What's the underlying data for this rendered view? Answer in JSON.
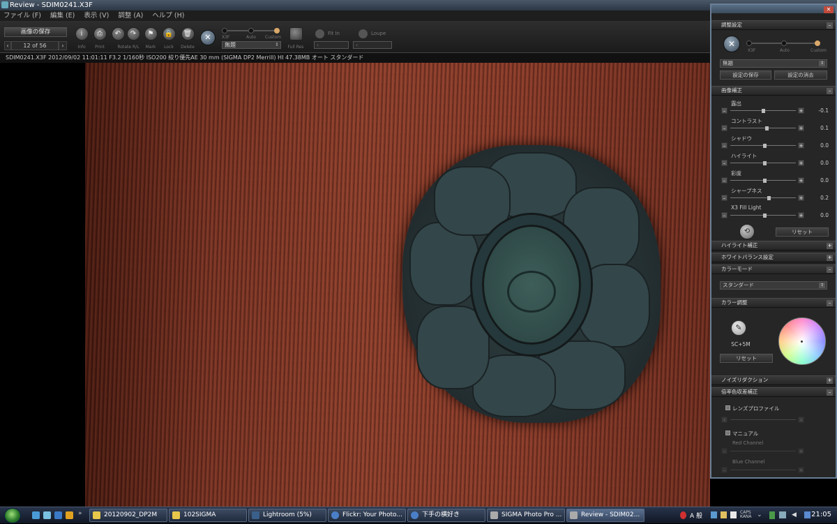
{
  "window": {
    "title": "Review - SDIM0241.X3F"
  },
  "menu": [
    "ファイル (F)",
    "編集 (E)",
    "表示 (V)",
    "調整 (A)",
    "ヘルプ (H)"
  ],
  "toolbar": {
    "save_label": "画像の保存",
    "pager": "12 of 56",
    "buttons": [
      {
        "name": "info",
        "label": "Info",
        "glyph": "i"
      },
      {
        "name": "print",
        "label": "Print",
        "glyph": "⎙"
      },
      {
        "name": "rotate-left",
        "label": "Rotate R/L",
        "glyph": "↶"
      },
      {
        "name": "rotate-right",
        "label": "",
        "glyph": "↷"
      },
      {
        "name": "mark",
        "label": "Mark",
        "glyph": "⚑"
      },
      {
        "name": "lock",
        "label": "Lock",
        "glyph": "🔒"
      },
      {
        "name": "delete",
        "label": "Delete",
        "glyph": "🗑"
      }
    ],
    "mode_labels": [
      "X3F",
      "Auto",
      "Custom"
    ],
    "preset_value": "無題",
    "fullres_label": "Full Res",
    "fitin_label": "Fit In",
    "loupe_label": "Loupe"
  },
  "infobar": "SDIM0241.X3F 2012/09/02 11:01:11 F3.2 1/160秒 ISO200 絞り優先AE 30 mm (SIGMA DP2 Merrill) HI 47.38MB オート スタンダード",
  "panel": {
    "sections": {
      "adjust": "調整設定",
      "image": "画像補正",
      "highlight": "ハイライト補正",
      "wb": "ホワイトバランス設定",
      "colormode": "カラーモード",
      "coloradj": "カラー調整",
      "noise": "ノイズリダクション",
      "aberration": "倍率色収差補正"
    },
    "mode_labels": [
      "X3F",
      "Auto",
      "Custom"
    ],
    "preset_value": "無題",
    "save_settings": "設定の保存",
    "clear_settings": "設定の消去",
    "sliders": [
      {
        "label": "露出",
        "value": "-0.1",
        "pos": 0.5
      },
      {
        "label": "コントラスト",
        "value": "0.1",
        "pos": 0.55
      },
      {
        "label": "シャドウ",
        "value": "0.0",
        "pos": 0.52
      },
      {
        "label": "ハイライト",
        "value": "0.0",
        "pos": 0.52
      },
      {
        "label": "彩度",
        "value": "0.0",
        "pos": 0.52
      },
      {
        "label": "シャープネス",
        "value": "0.2",
        "pos": 0.58
      },
      {
        "label": "X3 Fill Light",
        "value": "0.0",
        "pos": 0.52
      }
    ],
    "reset_label": "リセット",
    "colormode_value": "スタンダード",
    "color_readout": "SC+5M",
    "lens_profile": "レンズプロファイル",
    "manual": "マニュアル",
    "red_channel": "Red Channel",
    "blue_channel": "Blue Channel"
  },
  "taskbar": {
    "tasks": [
      {
        "label": "20120902_DP2M",
        "color": "#e8c84a"
      },
      {
        "label": "102SIGMA",
        "color": "#e8c84a"
      },
      {
        "label": "Lightroom (5%)",
        "color": "#3a5f8a"
      },
      {
        "label": "Flickr: Your Photo...",
        "color": "#4a7fc8"
      },
      {
        "label": "下手の横好き",
        "color": "#4a7fc8"
      },
      {
        "label": "SIGMA Photo Pro ...",
        "color": "#aaaaaa"
      },
      {
        "label": "Review - SDIM02...",
        "color": "#aaaaaa"
      }
    ],
    "clock": "21:05",
    "ime": "A 般"
  }
}
